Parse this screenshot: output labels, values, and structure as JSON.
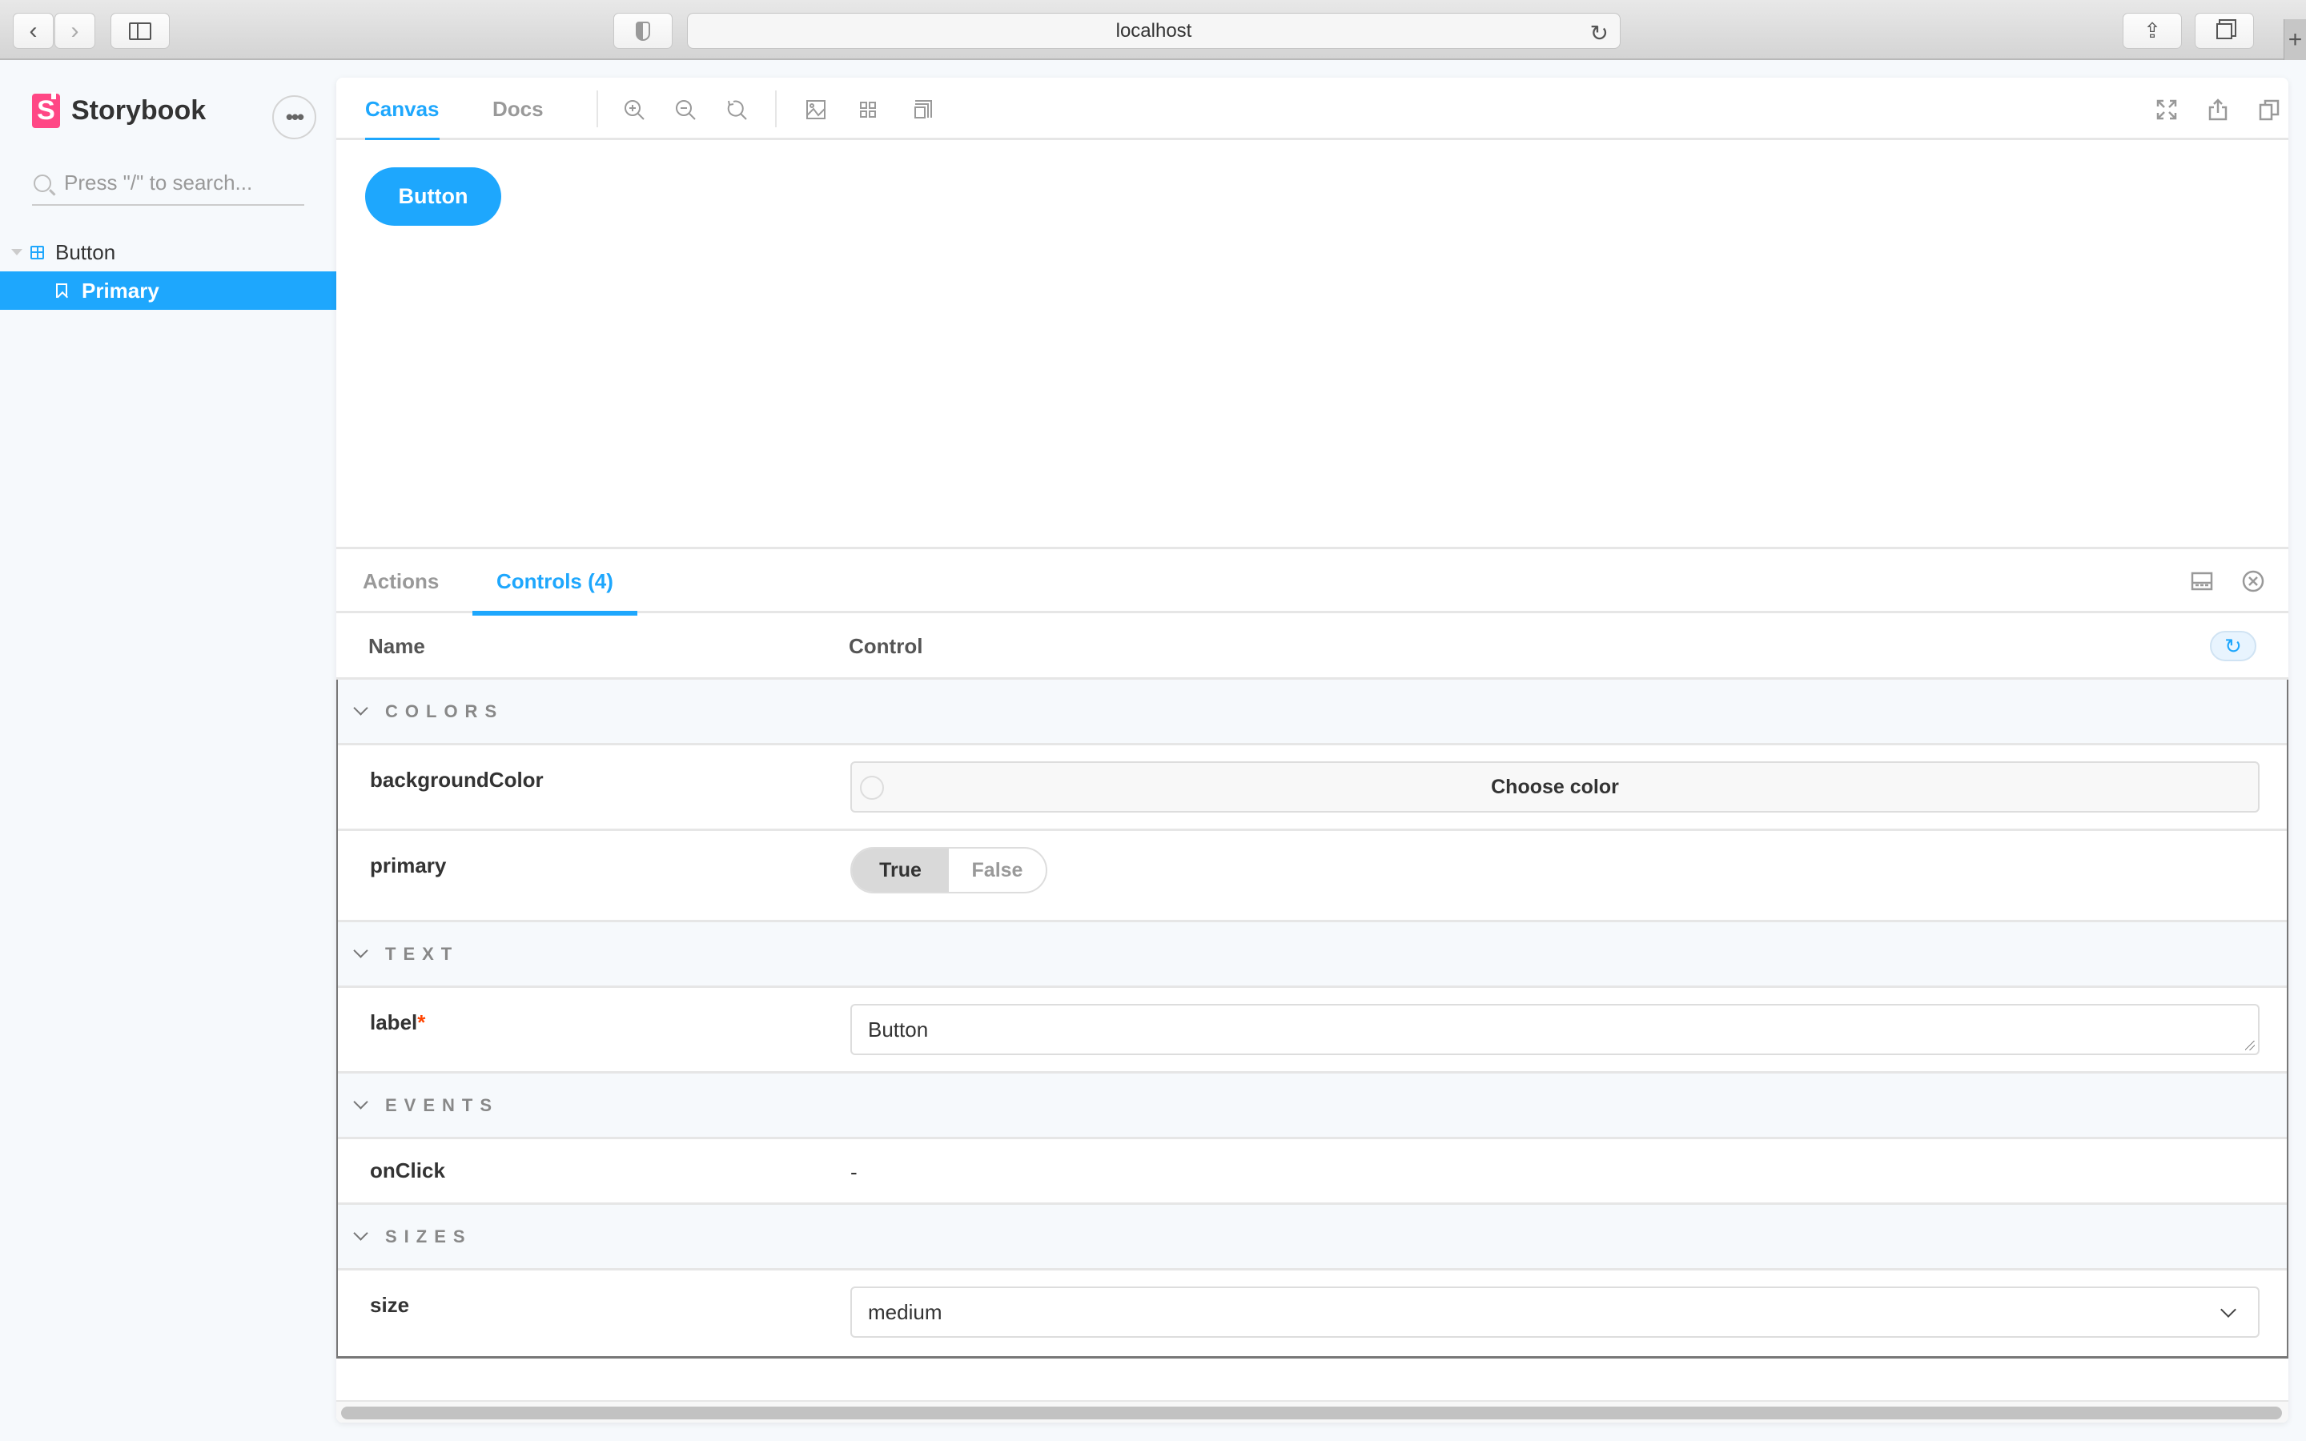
{
  "browser": {
    "url": "localhost",
    "icons": [
      "back-icon",
      "forward-icon",
      "sidebar-toggle-icon",
      "shield-icon",
      "reload-icon",
      "share-icon",
      "tabs-icon",
      "new-tab-icon"
    ],
    "new_tab_label": "+"
  },
  "sidebar": {
    "brand": "Storybook",
    "more_label": "•••",
    "search_placeholder": "Press \"/\" to search...",
    "tree": [
      {
        "type": "component",
        "label": "Button",
        "expanded": true
      },
      {
        "type": "story",
        "label": "Primary",
        "selected": true
      }
    ]
  },
  "toolbar": {
    "tabs": [
      {
        "label": "Canvas",
        "active": true
      },
      {
        "label": "Docs",
        "active": false
      }
    ],
    "tools": [
      "zoom-in-icon",
      "zoom-out-icon",
      "zoom-reset-icon",
      "background-icon",
      "grid-icon",
      "outline-icon"
    ],
    "right_tools": [
      "fullscreen-icon",
      "share-icon",
      "copy-icon"
    ]
  },
  "preview": {
    "button_label": "Button"
  },
  "addons": {
    "tabs": [
      {
        "label": "Actions",
        "active": false
      },
      {
        "label": "Controls (4)",
        "active": true
      }
    ],
    "right_tools": [
      "panel-orientation-icon",
      "close-icon"
    ]
  },
  "controls": {
    "header": {
      "name": "Name",
      "control": "Control"
    },
    "sections": [
      {
        "title": "COLORS",
        "rows": [
          {
            "name": "backgroundColor",
            "required": false,
            "control": {
              "type": "color",
              "label": "Choose color"
            }
          },
          {
            "name": "primary",
            "required": false,
            "control": {
              "type": "boolean",
              "options": [
                "True",
                "False"
              ],
              "value": "True"
            }
          }
        ]
      },
      {
        "title": "TEXT",
        "rows": [
          {
            "name": "label",
            "required": true,
            "control": {
              "type": "text",
              "value": "Button"
            }
          }
        ]
      },
      {
        "title": "EVENTS",
        "rows": [
          {
            "name": "onClick",
            "required": false,
            "control": {
              "type": "none",
              "value": "-"
            }
          }
        ]
      },
      {
        "title": "SIZES",
        "rows": [
          {
            "name": "size",
            "required": false,
            "control": {
              "type": "select",
              "value": "medium"
            }
          }
        ]
      }
    ],
    "required_marker": "*"
  },
  "colors": {
    "accent": "#1ea7fd",
    "brand": "#ff4785",
    "required": "#ff4400"
  }
}
